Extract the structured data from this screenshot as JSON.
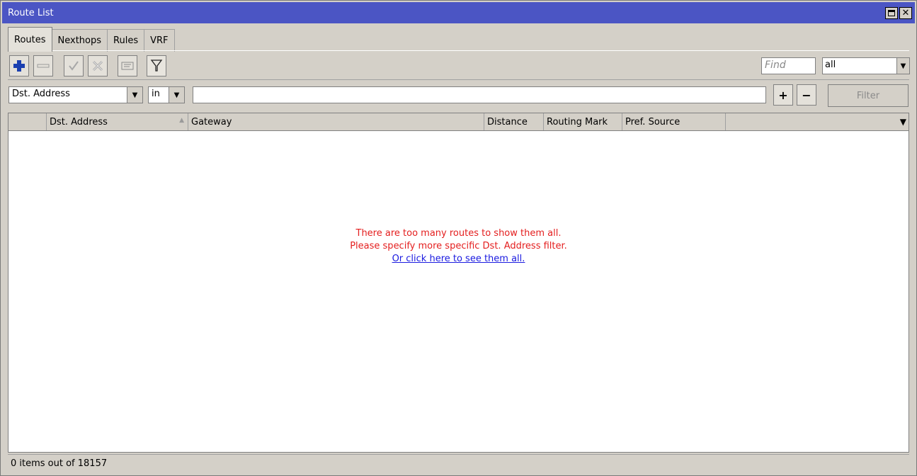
{
  "window": {
    "title": "Route List"
  },
  "tabs": [
    {
      "label": "Routes",
      "active": true
    },
    {
      "label": "Nexthops",
      "active": false
    },
    {
      "label": "Rules",
      "active": false
    },
    {
      "label": "VRF",
      "active": false
    }
  ],
  "toolbar": {
    "add_icon": "plus-icon",
    "remove_icon": "minus-icon",
    "enable_icon": "check-icon",
    "disable_icon": "x-icon",
    "comment_icon": "comment-icon",
    "filter_icon": "funnel-icon",
    "find_placeholder": "Find",
    "scope_value": "all"
  },
  "filter": {
    "field_value": "Dst. Address",
    "operator_value": "in",
    "value": "",
    "add_label": "+",
    "remove_label": "−",
    "filter_button_label": "Filter"
  },
  "table": {
    "columns": [
      {
        "key": "flags",
        "label": ""
      },
      {
        "key": "dst",
        "label": "Dst. Address",
        "sorted": "asc"
      },
      {
        "key": "gateway",
        "label": "Gateway"
      },
      {
        "key": "distance",
        "label": "Distance"
      },
      {
        "key": "routing_mark",
        "label": "Routing Mark"
      },
      {
        "key": "pref_source",
        "label": "Pref. Source"
      }
    ],
    "rows": [],
    "message_line1": "There are too many routes to show them all.",
    "message_line2": "Please specify more specific Dst. Address filter.",
    "message_link": "Or click here to see them all."
  },
  "status": {
    "text": "0 items out of 18157"
  },
  "colors": {
    "titlebar": "#4b55c4",
    "warning_text": "#e41e1e",
    "link_text": "#1a1ae0",
    "add_icon": "#1a3fb0"
  }
}
